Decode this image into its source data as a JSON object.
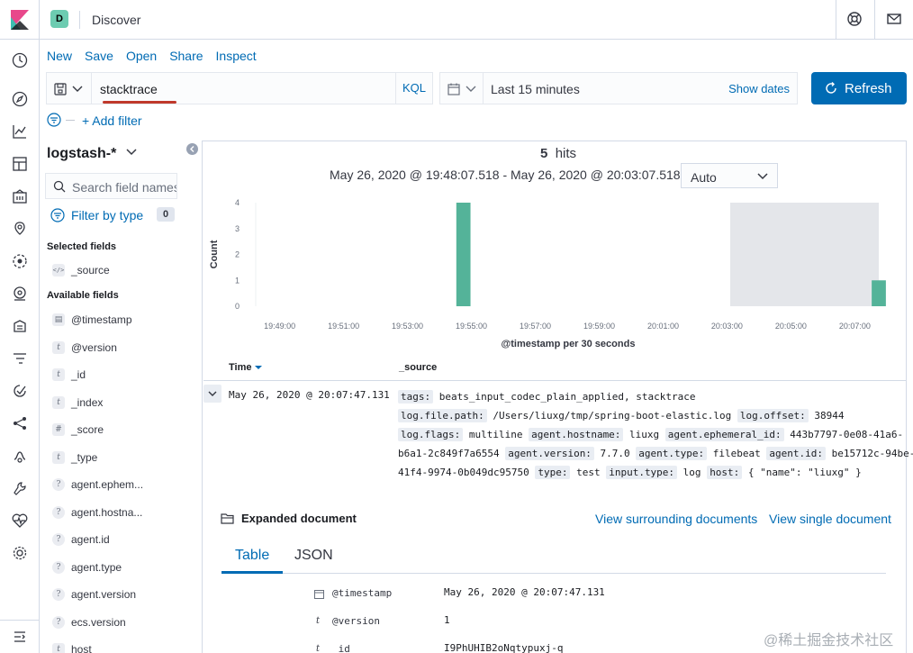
{
  "header": {
    "space_initial": "D",
    "app_title": "Discover"
  },
  "menu": [
    "New",
    "Save",
    "Open",
    "Share",
    "Inspect"
  ],
  "query": {
    "value": "stacktrace",
    "language": "KQL"
  },
  "time": {
    "label": "Last 15 minutes",
    "show_dates": "Show dates",
    "refresh": "Refresh"
  },
  "filters": {
    "add_label": "+ Add filter"
  },
  "sidebar": {
    "index_pattern": "logstash-*",
    "search_placeholder": "Search field names",
    "filter_by_type": "Filter by type",
    "filter_count": "0",
    "selected_title": "Selected fields",
    "selected": [
      {
        "type": "</>",
        "name": "_source"
      }
    ],
    "available_title": "Available fields",
    "available": [
      {
        "type": "date",
        "name": "@timestamp"
      },
      {
        "type": "t",
        "name": "@version"
      },
      {
        "type": "t",
        "name": "_id"
      },
      {
        "type": "t",
        "name": "_index"
      },
      {
        "type": "#",
        "name": "_score"
      },
      {
        "type": "t",
        "name": "_type"
      },
      {
        "type": "?",
        "name": "agent.ephem..."
      },
      {
        "type": "?",
        "name": "agent.hostna..."
      },
      {
        "type": "?",
        "name": "agent.id"
      },
      {
        "type": "?",
        "name": "agent.type"
      },
      {
        "type": "?",
        "name": "agent.version"
      },
      {
        "type": "?",
        "name": "ecs.version"
      },
      {
        "type": "t",
        "name": "host"
      }
    ]
  },
  "results": {
    "hits_count": "5",
    "hits_label": "hits",
    "range": "May 26, 2020 @ 19:48:07.518 - May 26, 2020 @ 20:03:07.518 —",
    "interval": "Auto"
  },
  "chart_data": {
    "type": "bar",
    "xlabel": "@timestamp per 30 seconds",
    "ylabel": "Count",
    "ylim": [
      0,
      4
    ],
    "yticks": [
      0,
      1,
      2,
      3,
      4
    ],
    "x_ticks": [
      "19:49:00",
      "19:51:00",
      "19:53:00",
      "19:55:00",
      "19:57:00",
      "19:59:00",
      "20:01:00",
      "20:03:00",
      "20:05:00",
      "20:07:00"
    ],
    "x_start_minutes_after_1948": 0.25,
    "x_end_minutes_after_1948": 19.75,
    "bars": [
      {
        "time": "19:54:30",
        "minute": 6.5,
        "value": 4
      },
      {
        "time": "20:07:30",
        "minute": 19.5,
        "value": 1
      }
    ],
    "shaded_region": {
      "from_minute": 15.1,
      "to_minute": 19.75
    },
    "bar_color": "#54b399"
  },
  "table": {
    "col_time": "Time",
    "col_source": "_source",
    "row_time": "May 26, 2020 @ 20:07:47.131",
    "source_lines": [
      [
        {
          "k": "tags:"
        },
        {
          "v": " beats_input_codec_plain_applied, stacktrace"
        }
      ],
      [
        {
          "k": "log.file.path:"
        },
        {
          "v": " /Users/liuxg/tmp/spring-boot-elastic.log "
        },
        {
          "k": "log.offset:"
        },
        {
          "v": " 38944"
        }
      ],
      [
        {
          "k": "log.flags:"
        },
        {
          "v": " multiline "
        },
        {
          "k": "agent.hostname:"
        },
        {
          "v": " liuxg "
        },
        {
          "k": "agent.ephemeral_id:"
        },
        {
          "v": " 443b7797-0e08-41a6-"
        }
      ],
      [
        {
          "v": "b6a1-2c849f7a6554 "
        },
        {
          "k": "agent.version:"
        },
        {
          "v": " 7.7.0 "
        },
        {
          "k": "agent.type:"
        },
        {
          "v": " filebeat "
        },
        {
          "k": "agent.id:"
        },
        {
          "v": " be15712c-94be-"
        }
      ],
      [
        {
          "v": "41f4-9974-0b049dc95750 "
        },
        {
          "k": "type:"
        },
        {
          "v": " test "
        },
        {
          "k": "input.type:"
        },
        {
          "v": " log "
        },
        {
          "k": "host:"
        },
        {
          "v": " { \"name\": \"liuxg\" }"
        }
      ]
    ]
  },
  "expanded": {
    "title": "Expanded document",
    "surrounding": "View surrounding documents",
    "single": "View single document",
    "tab_table": "Table",
    "tab_json": "JSON",
    "fields": [
      {
        "icon": "date",
        "key": "@timestamp",
        "value": "May 26, 2020 @ 20:07:47.131"
      },
      {
        "icon": "t",
        "key": "@version",
        "value": "1"
      },
      {
        "icon": "t",
        "key": "_id",
        "value": "I9PhUHIB2oNqtypuxj-q"
      }
    ]
  },
  "watermark": "@稀土掘金技术社区",
  "colors": {
    "accent": "#006bb4",
    "bar": "#54b399",
    "border": "#d3dae6"
  }
}
